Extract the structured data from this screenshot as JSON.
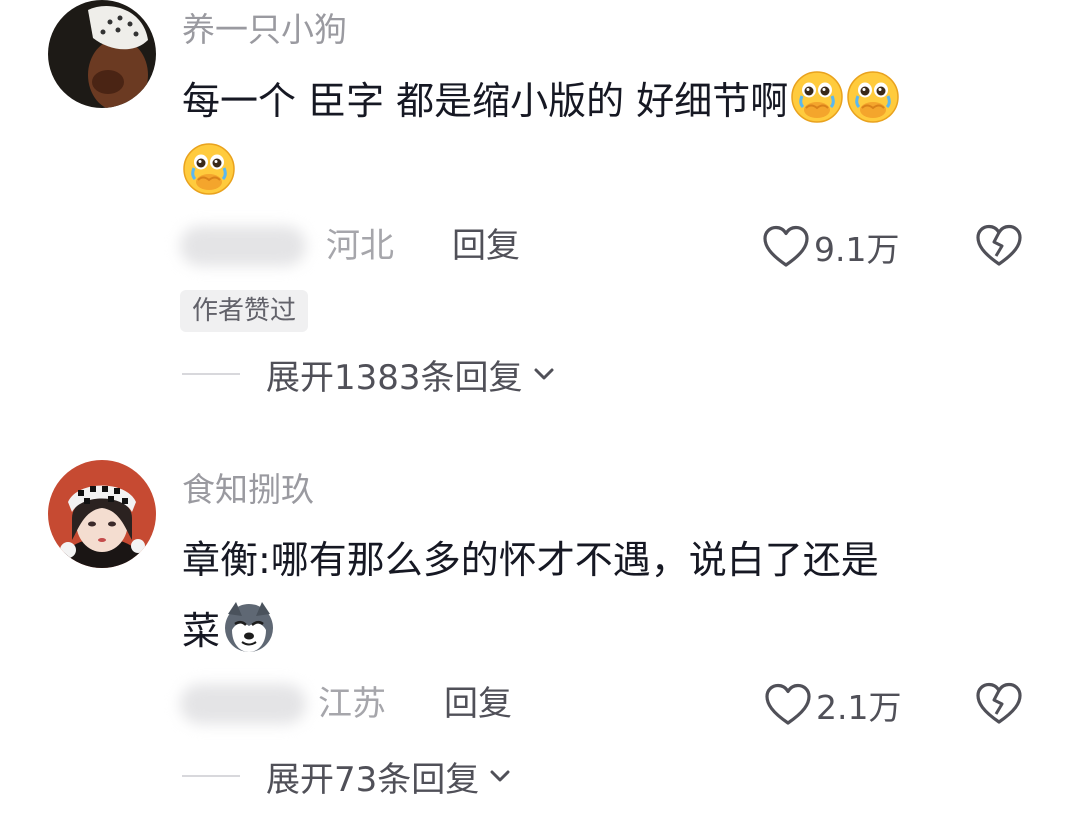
{
  "comments": [
    {
      "username": "养一只小狗",
      "text_line1": "每一个 臣字 都是缩小版的 好细节啊",
      "location": "河北",
      "reply_label": "回复",
      "likes": "9.1万",
      "badge": "作者赞过",
      "expand_label": "展开1383条回复",
      "emoji": "crying-pleading-emoji"
    },
    {
      "username": "食知捌玖",
      "text_line1": "章衡:哪有那么多的怀才不遇，说白了还是",
      "text_line2": "菜",
      "location": "江苏",
      "reply_label": "回复",
      "likes": "2.1万",
      "expand_label": "展开73条回复",
      "emoji": "husky-dog-emoji"
    }
  ],
  "colors": {
    "text": "#161823",
    "username": "#9a9aa0",
    "secondary": "#505058",
    "badge_bg": "#f0f0f1"
  }
}
